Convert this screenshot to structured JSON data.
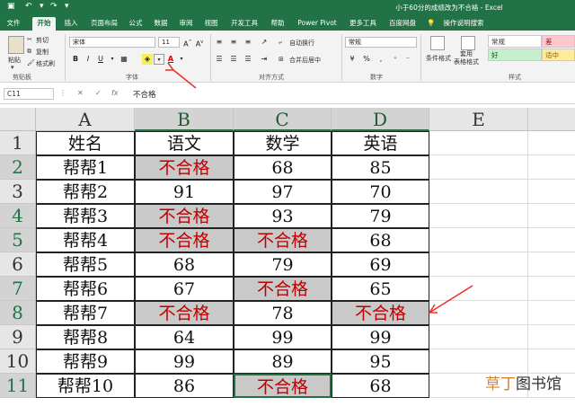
{
  "title_bar": {
    "title": "小于60分的成绩改为不合格 - Excel"
  },
  "tabs": [
    "文件",
    "开始",
    "插入",
    "页面布局",
    "公式",
    "数据",
    "审阅",
    "视图",
    "开发工具",
    "帮助",
    "Power Pivot",
    "更多工具",
    "百度网盘",
    "操作说明搜索"
  ],
  "ribbon": {
    "clipboard": {
      "paste": "粘贴",
      "cut": "剪切",
      "copy": "复制",
      "format_painter": "格式刷",
      "label": "剪贴板"
    },
    "font": {
      "font_name": "宋体",
      "font_size": "11",
      "bold": "B",
      "italic": "I",
      "underline": "U",
      "font_color": "A",
      "label": "字体"
    },
    "alignment": {
      "wrap_text": "自动换行",
      "merge_center": "合并后居中",
      "label": "对齐方式"
    },
    "number": {
      "format": "常规",
      "percent": "%",
      "comma": ",",
      "label": "数字"
    },
    "styles": {
      "conditional": "条件格式",
      "table_format": "套用\n表格格式",
      "normal": "常规",
      "bad": "差",
      "good": "好",
      "neutral": "适中",
      "label": "样式"
    }
  },
  "formula_bar": {
    "name_box": "C11",
    "fx": "fx",
    "content": "不合格"
  },
  "sheet": {
    "columns": [
      "A",
      "B",
      "C",
      "D",
      "E"
    ],
    "rows": [
      {
        "num": "1",
        "cells": [
          "姓名",
          "语文",
          "数学",
          "英语",
          ""
        ]
      },
      {
        "num": "2",
        "cells": [
          "帮帮1",
          "不合格",
          "68",
          "85",
          ""
        ]
      },
      {
        "num": "3",
        "cells": [
          "帮帮2",
          "91",
          "97",
          "70",
          ""
        ]
      },
      {
        "num": "4",
        "cells": [
          "帮帮3",
          "不合格",
          "93",
          "79",
          ""
        ]
      },
      {
        "num": "5",
        "cells": [
          "帮帮4",
          "不合格",
          "不合格",
          "68",
          ""
        ]
      },
      {
        "num": "6",
        "cells": [
          "帮帮5",
          "68",
          "79",
          "69",
          ""
        ]
      },
      {
        "num": "7",
        "cells": [
          "帮帮6",
          "67",
          "不合格",
          "65",
          ""
        ]
      },
      {
        "num": "8",
        "cells": [
          "帮帮7",
          "不合格",
          "78",
          "不合格",
          ""
        ]
      },
      {
        "num": "9",
        "cells": [
          "帮帮8",
          "64",
          "99",
          "99",
          ""
        ]
      },
      {
        "num": "10",
        "cells": [
          "帮帮9",
          "99",
          "89",
          "95",
          ""
        ]
      },
      {
        "num": "11",
        "cells": [
          "帮帮10",
          "86",
          "不合格",
          "68",
          ""
        ]
      }
    ]
  },
  "watermark": {
    "part1": "草丁",
    "part2": "图书馆"
  },
  "colors": {
    "excel_green": "#217346",
    "fail_text": "#c00000",
    "fail_fill": "#c9c9c9",
    "arrow": "#e8302a"
  }
}
